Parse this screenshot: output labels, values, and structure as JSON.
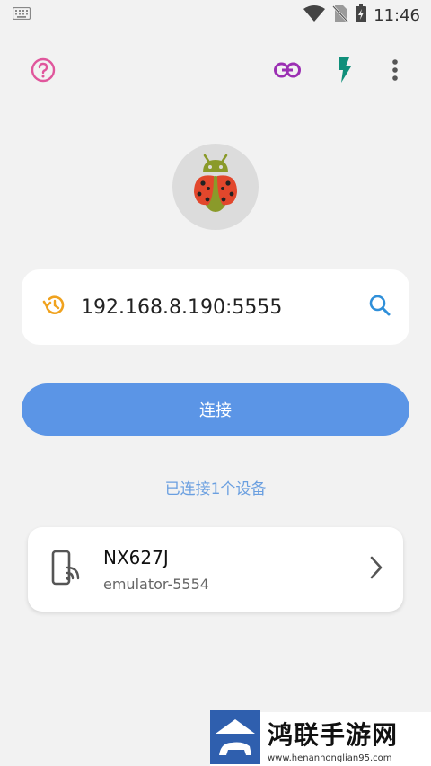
{
  "status_bar": {
    "time": "11:46",
    "icons": [
      "keyboard-icon",
      "wifi-icon",
      "no-sim-icon",
      "battery-charging-icon"
    ]
  },
  "toolbar": {
    "icons": [
      "help-icon",
      "link-icon",
      "flash-icon",
      "more-vert-icon"
    ],
    "colors": {
      "help": "#e0569c",
      "link": "#9b2fb3",
      "flash": "#0f8f7a",
      "more": "#555555"
    }
  },
  "logo": {
    "icon": "ladybug-android-icon"
  },
  "address": {
    "value": "192.168.8.190:5555",
    "history_icon": "history-icon",
    "search_icon": "search-icon"
  },
  "connect_button": {
    "label": "连接",
    "color": "#5b95e6"
  },
  "connected_status": "已连接1个设备",
  "devices": [
    {
      "name": "NX627J",
      "serial": "emulator-5554",
      "icon": "phone-wifi-icon"
    }
  ],
  "watermark": {
    "title": "鸿联手游网",
    "url": "www.henanhonglian95.com"
  }
}
